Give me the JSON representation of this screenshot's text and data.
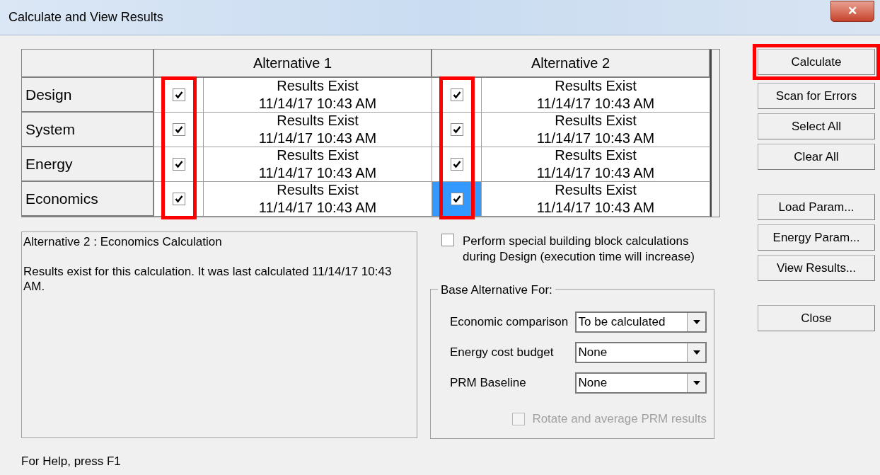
{
  "window": {
    "title": "Calculate and View Results",
    "close": "✕"
  },
  "grid": {
    "alternatives": [
      {
        "label": "Alternative 1",
        "highlighted": true
      },
      {
        "label": "Alternative 2",
        "highlighted": true
      }
    ],
    "rows": [
      {
        "label": "Design",
        "cells": [
          {
            "checked": true,
            "selected": false,
            "status": "Results Exist",
            "time": "11/14/17 10:43 AM"
          },
          {
            "checked": true,
            "selected": false,
            "status": "Results Exist",
            "time": "11/14/17 10:43 AM"
          }
        ]
      },
      {
        "label": "System",
        "cells": [
          {
            "checked": true,
            "selected": false,
            "status": "Results Exist",
            "time": "11/14/17 10:43 AM"
          },
          {
            "checked": true,
            "selected": false,
            "status": "Results Exist",
            "time": "11/14/17 10:43 AM"
          }
        ]
      },
      {
        "label": "Energy",
        "cells": [
          {
            "checked": true,
            "selected": false,
            "status": "Results Exist",
            "time": "11/14/17 10:43 AM"
          },
          {
            "checked": true,
            "selected": false,
            "status": "Results Exist",
            "time": "11/14/17 10:43 AM"
          }
        ]
      },
      {
        "label": "Economics",
        "cells": [
          {
            "checked": true,
            "selected": false,
            "status": "Results Exist",
            "time": "11/14/17 10:43 AM"
          },
          {
            "checked": true,
            "selected": true,
            "status": "Results Exist",
            "time": "11/14/17 10:43 AM"
          }
        ]
      }
    ]
  },
  "info": {
    "heading": "Alternative 2 : Economics Calculation",
    "message": "Results exist for this calculation.  It was last calculated 11/14/17 10:43 AM."
  },
  "special_calc": {
    "label": "Perform special building block calculations during Design (execution time will increase)",
    "checked": false
  },
  "base_alternative": {
    "title": "Base Alternative For:",
    "fields": [
      {
        "label": "Economic comparison",
        "value": "To be calculated"
      },
      {
        "label": "Energy cost budget",
        "value": "None"
      },
      {
        "label": "PRM Baseline",
        "value": "None"
      }
    ],
    "rotate": {
      "label": "Rotate and average PRM results",
      "checked": false,
      "disabled": true
    }
  },
  "button_groups": [
    [
      {
        "label": "Calculate",
        "highlighted": true
      },
      {
        "label": "Scan for Errors",
        "highlighted": false
      },
      {
        "label": "Select All",
        "highlighted": false
      },
      {
        "label": "Clear All",
        "highlighted": false
      }
    ],
    [
      {
        "label": "Load Param...",
        "highlighted": false
      },
      {
        "label": "Energy Param...",
        "highlighted": false
      },
      {
        "label": "View Results...",
        "highlighted": false
      }
    ],
    [
      {
        "label": "Close",
        "highlighted": false
      }
    ]
  ],
  "status_bar": {
    "text": "For Help, press F1"
  }
}
